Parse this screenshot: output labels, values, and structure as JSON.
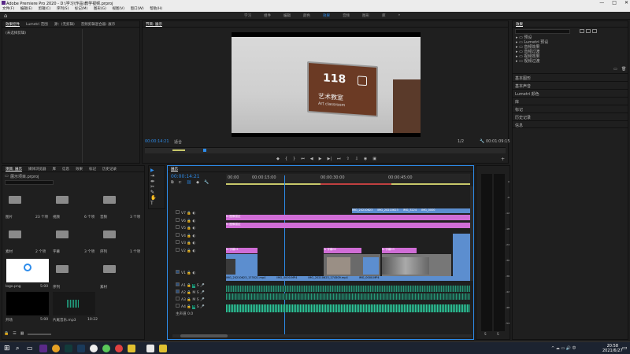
{
  "window": {
    "title": "Adobe Premiere Pro 2020 - D:\\学习\\作品\\教学视频.prproj"
  },
  "menubar": [
    "文件(F)",
    "编辑(E)",
    "剪辑(C)",
    "序列(S)",
    "标记(M)",
    "图形(G)",
    "视图(V)",
    "窗口(W)",
    "帮助(H)"
  ],
  "workspaces": {
    "tabs": [
      "学习",
      "组件",
      "编辑",
      "颜色",
      "效果",
      "音频",
      "图形",
      "库"
    ],
    "active": "效果"
  },
  "source_panel": {
    "tabs": [
      "效果控件",
      "Lumetri 范围",
      "源：(无剪辑)",
      "音频剪辑混合器: 展示"
    ],
    "empty_text": "(未选择剪辑)"
  },
  "program": {
    "title": "节目: 展示",
    "sign_number": "118",
    "sign_text_cn": "艺术教室",
    "sign_text_en": "Art classroom",
    "timecode": "00:00:14:21",
    "fit": "适合",
    "ratio": "1/2",
    "duration": "00:01:09:15"
  },
  "project": {
    "tabs": [
      "项目: 展示",
      "媒体浏览器",
      "库",
      "信息",
      "效果",
      "标记",
      "历史记录"
    ],
    "path": "展示项目.prproj",
    "items": [
      {
        "name": "图片",
        "meta": "23 个项"
      },
      {
        "name": "视频",
        "meta": "6 个项"
      },
      {
        "name": "音频",
        "meta": "3 个项"
      },
      {
        "name": "素材",
        "meta": "2 个项"
      },
      {
        "name": "字幕",
        "meta": "3 个项"
      },
      {
        "name": "序列",
        "meta": "1 个项"
      },
      {
        "name": "logo.png",
        "meta": "5:00"
      },
      {
        "name": "序列",
        "meta": ""
      },
      {
        "name": "素材",
        "meta": ""
      },
      {
        "name": "开场",
        "meta": "5:00"
      },
      {
        "name": "片尾音乐.mp3",
        "meta": "10:22"
      }
    ]
  },
  "timeline": {
    "title": "展示",
    "timecode": "00:00:14:21",
    "ruler": [
      "00:00",
      "00:00:15:00",
      "00:00:30:00",
      "00:00:45:00"
    ],
    "video_tracks": [
      "V7",
      "V6",
      "V5",
      "V4",
      "V3",
      "V2",
      "V1"
    ],
    "audio_tracks": [
      "A1",
      "A2",
      "A3",
      "A4"
    ],
    "master": "主声道",
    "master_value": "0.0",
    "v_clips": {
      "v7": [
        "fx 图像描边",
        "fx 图像描边"
      ],
      "v3": [
        "fx 字幕01",
        "fx 字幕02",
        "fx 字幕03"
      ],
      "v1": [
        "IMG_20210623_173521.mp4",
        "IMG_0000.MP4",
        "IMG_20210623_174509.mp4",
        "IMG_0000.MP4"
      ],
      "v8": [
        "IMG_20210623",
        "IMG_20210623",
        "IMG_3224",
        "IMG_0000"
      ]
    }
  },
  "effects_panel": {
    "title": "效果",
    "tree": [
      "预设",
      "Lumetri 预设",
      "音频效果",
      "音频过渡",
      "视频效果",
      "视频过渡"
    ],
    "sections": [
      "基本图形",
      "基本声音",
      "Lumetri 颜色",
      "库",
      "标记",
      "历史记录",
      "信息"
    ]
  },
  "meter_scale": [
    "0",
    "-6",
    "-12",
    "-18",
    "-24",
    "-30",
    "-36",
    "-42",
    "-48",
    "-54"
  ],
  "taskbar": {
    "time": "20:58",
    "date": "2021/6/27"
  },
  "colors": {
    "accent": "#2d8ceb",
    "pink": "#d06dd6",
    "clipblue": "#5c8ecf",
    "green": "#20a080"
  }
}
